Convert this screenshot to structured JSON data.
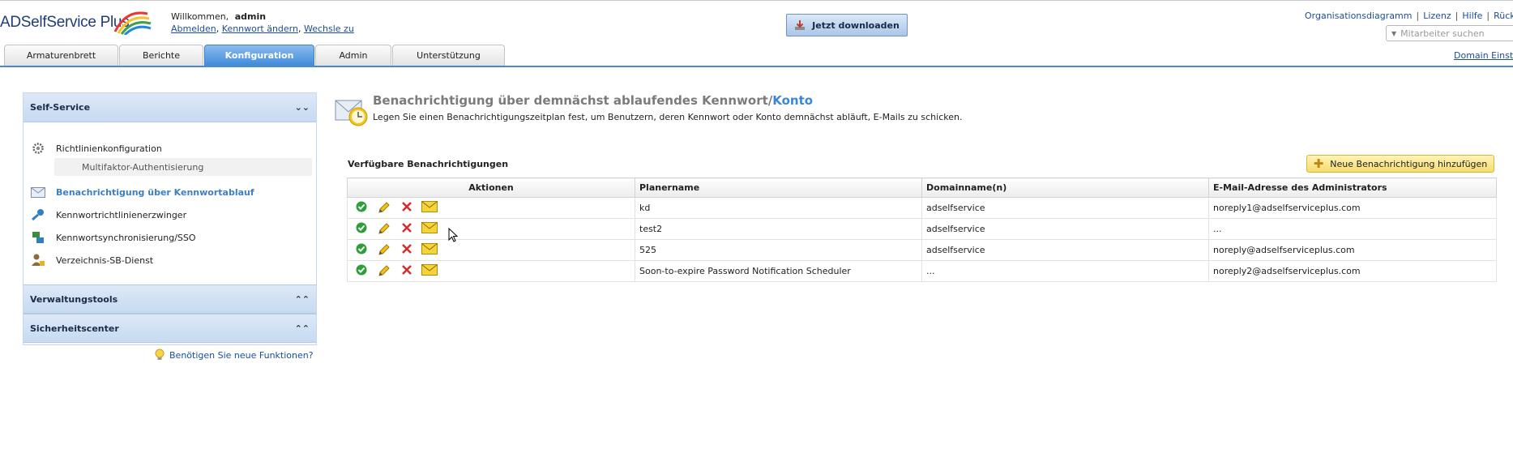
{
  "header": {
    "logo_text": "ADSelfService Plus",
    "welcome_label": "Willkommen,",
    "username": "admin",
    "links": [
      {
        "label": "Abmelden"
      },
      {
        "label": "Kennwort ändern"
      },
      {
        "label": "Wechsle zu"
      }
    ],
    "download_label": "Jetzt downloaden",
    "top_links": [
      {
        "label": "Organisationsdiagramm"
      },
      {
        "label": "Lizenz"
      },
      {
        "label": "Hilfe"
      },
      {
        "label": "Rückm"
      }
    ],
    "search_placeholder": "Mitarbeiter suchen",
    "domain_settings_label": "Domain Einst"
  },
  "tabs": [
    {
      "label": "Armaturenbrett",
      "active": false
    },
    {
      "label": "Berichte",
      "active": false
    },
    {
      "label": "Konfiguration",
      "active": true
    },
    {
      "label": "Admin",
      "active": false
    },
    {
      "label": "Unterstützung",
      "active": false
    }
  ],
  "sidebar": {
    "panels": [
      {
        "title": "Self-Service",
        "expanded": true
      },
      {
        "title": "Verwaltungstools",
        "expanded": false
      },
      {
        "title": "Sicherheitscenter",
        "expanded": false
      }
    ],
    "items": [
      {
        "label": "Richtlinienkonfiguration",
        "icon": "gear-icon"
      },
      {
        "label": "Multifaktor-Authentisierung",
        "icon": ""
      },
      {
        "label": "Benachrichtigung über Kennwortablauf",
        "icon": "envelope-icon",
        "active": true
      },
      {
        "label": "Kennwortrichtlinienerzwinger",
        "icon": "key-icon"
      },
      {
        "label": "Kennwortsynchronisierung/SSO",
        "icon": "sync-icon"
      },
      {
        "label": "Verzeichnis-SB-Dienst",
        "icon": "user-lock-icon"
      }
    ],
    "feature_link": "Benötigen Sie neue Funktionen?"
  },
  "main": {
    "title_main": "Benachrichtigung über demnächst ablaufendes Kennwort/",
    "title_highlight": "Konto",
    "description": "Legen Sie einen Benachrichtigungszeitplan fest, um Benutzern, deren Kennwort oder Konto demnächst abläuft, E-Mails zu schicken.",
    "section_title": "Verfügbare Benachrichtigungen",
    "add_button": "Neue Benachrichtigung hinzufügen",
    "table": {
      "headers": [
        "Aktionen",
        "Planername",
        "Domainname(n)",
        "E-Mail-Adresse des Administrators"
      ],
      "rows": [
        {
          "scheduler": "kd",
          "domain": "adselfservice",
          "email": "noreply1@adselfserviceplus.com"
        },
        {
          "scheduler": "test2",
          "domain": "adselfservice",
          "email": "..."
        },
        {
          "scheduler": "525",
          "domain": "adselfservice",
          "email": "noreply@adselfserviceplus.com"
        },
        {
          "scheduler": "Soon-to-expire Password Notification Scheduler",
          "domain": "...",
          "email": "noreply2@adselfserviceplus.com"
        }
      ]
    }
  },
  "colors": {
    "accent": "#3f8ad8",
    "active_link": "#3c7fc9",
    "panel_header": "#c6daf1",
    "add_button": "#f5dc6e"
  }
}
